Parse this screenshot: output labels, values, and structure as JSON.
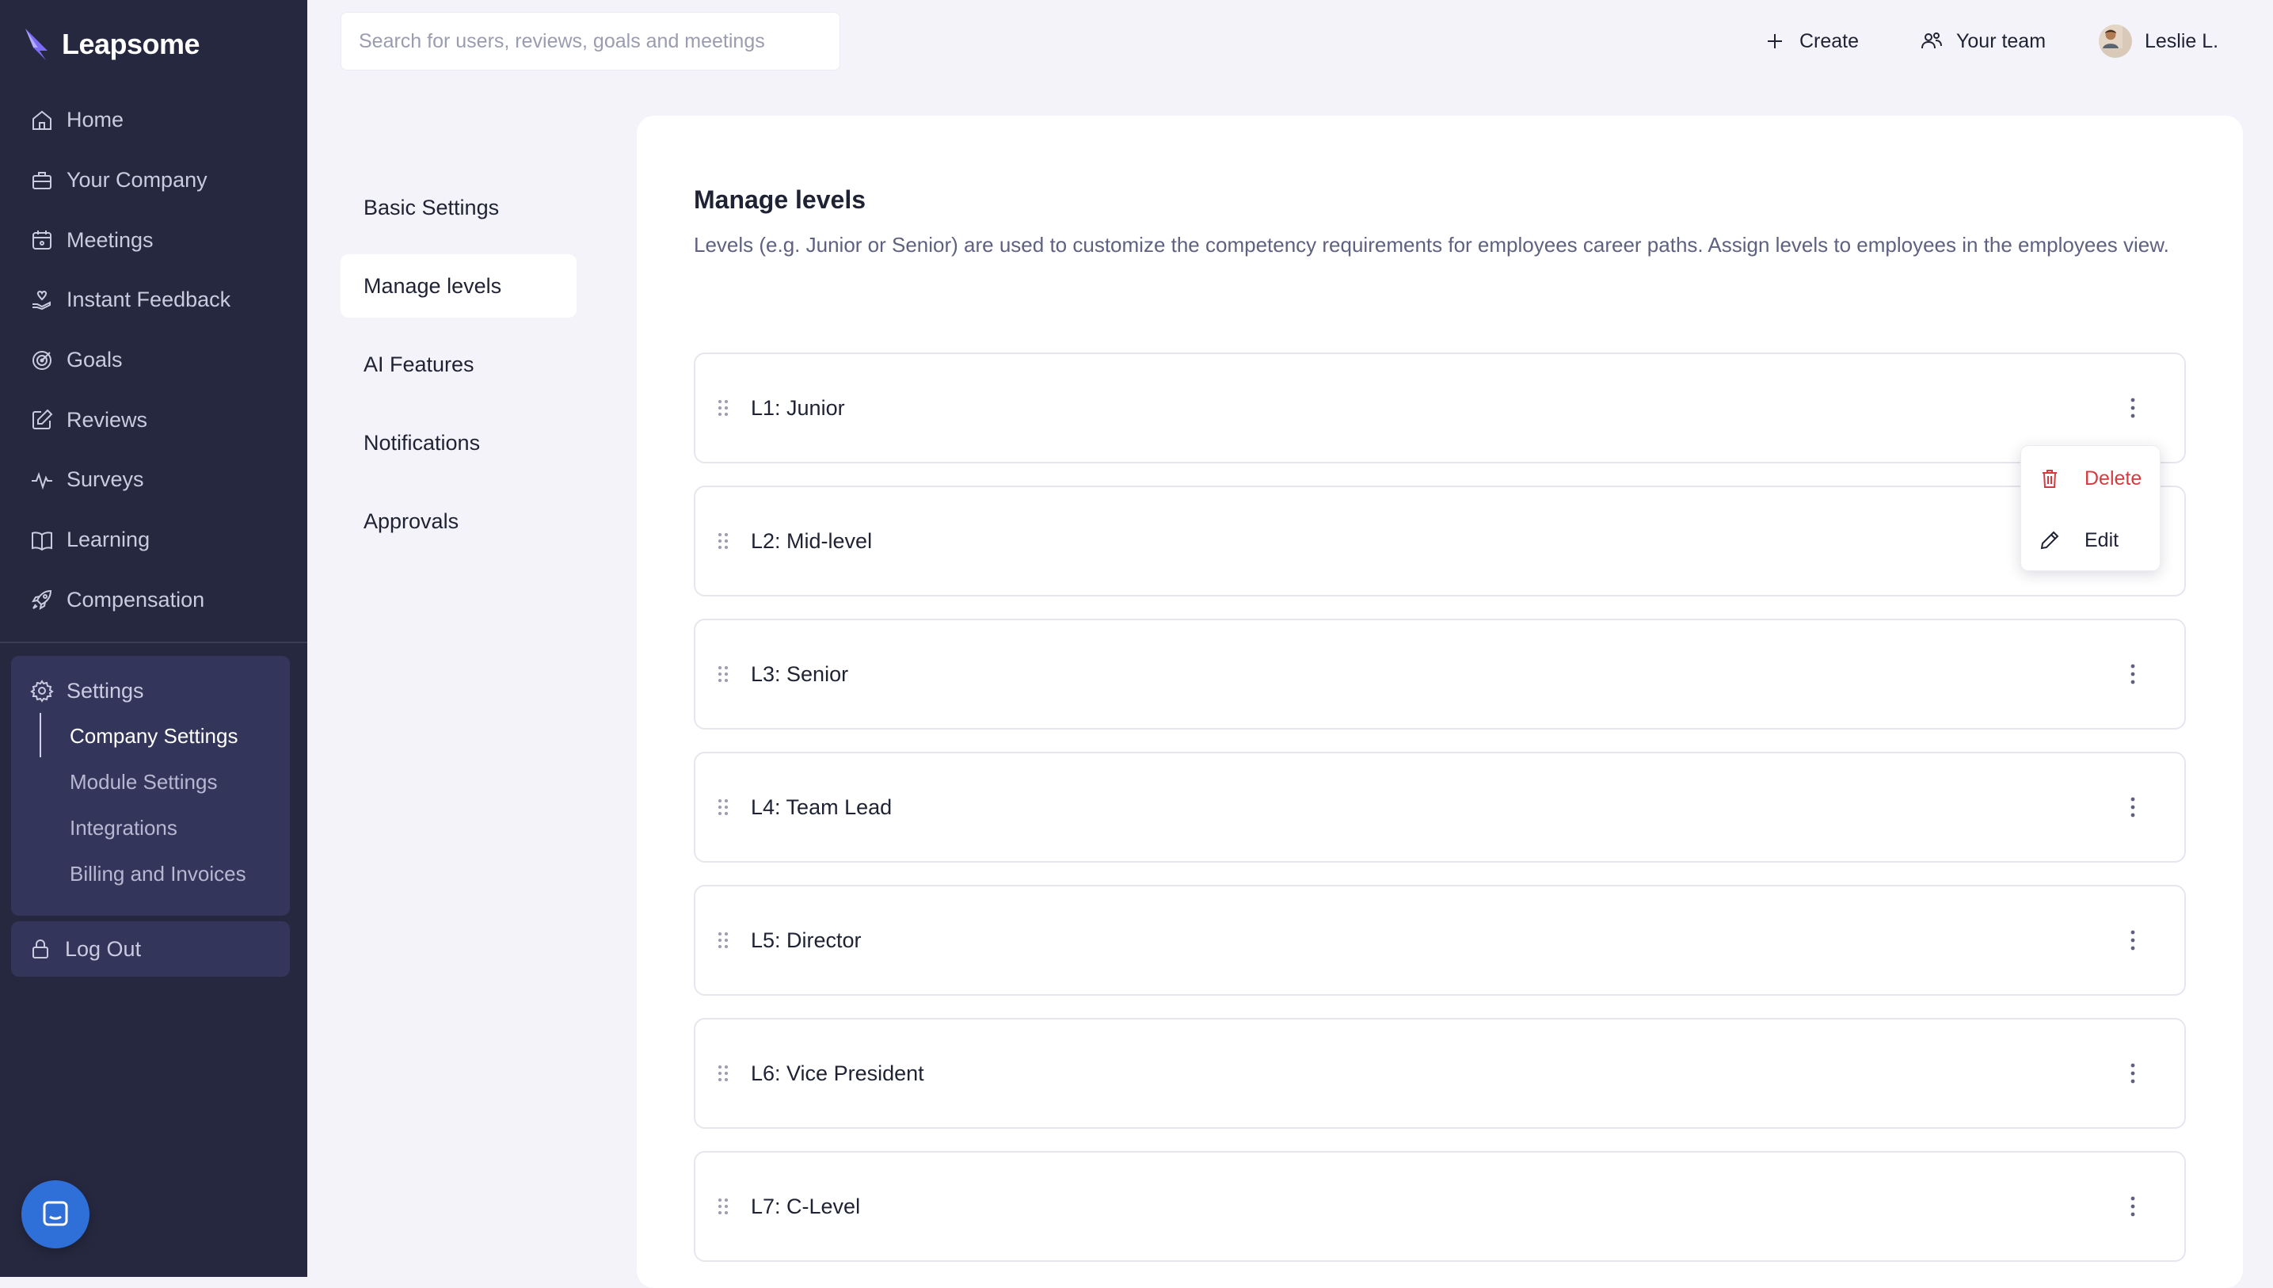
{
  "app": {
    "name": "Leapsome"
  },
  "sidebar": {
    "items": [
      {
        "label": "Home",
        "icon": "home-icon"
      },
      {
        "label": "Your Company",
        "icon": "briefcase-icon"
      },
      {
        "label": "Meetings",
        "icon": "calendar-icon"
      },
      {
        "label": "Instant Feedback",
        "icon": "hand-heart-icon"
      },
      {
        "label": "Goals",
        "icon": "target-icon"
      },
      {
        "label": "Reviews",
        "icon": "pen-square-icon"
      },
      {
        "label": "Surveys",
        "icon": "pulse-icon"
      },
      {
        "label": "Learning",
        "icon": "book-icon"
      },
      {
        "label": "Compensation",
        "icon": "rocket-icon"
      }
    ],
    "settings": {
      "label": "Settings",
      "sub_items": [
        {
          "label": "Company Settings",
          "active": true
        },
        {
          "label": "Module Settings",
          "active": false
        },
        {
          "label": "Integrations",
          "active": false
        },
        {
          "label": "Billing and Invoices",
          "active": false
        }
      ]
    },
    "logout_label": "Log Out"
  },
  "header": {
    "search_placeholder": "Search for users, reviews, goals and meetings",
    "create_label": "Create",
    "team_label": "Your team",
    "user_name": "Leslie L."
  },
  "subnav": {
    "items": [
      {
        "label": "Basic Settings",
        "active": false
      },
      {
        "label": "Manage levels",
        "active": true
      },
      {
        "label": "AI Features",
        "active": false
      },
      {
        "label": "Notifications",
        "active": false
      },
      {
        "label": "Approvals",
        "active": false
      }
    ]
  },
  "main": {
    "title": "Manage levels",
    "description": "Levels (e.g. Junior or Senior) are used to customize the competency requirements for employees career paths. Assign levels to employees in the employees view.",
    "levels": [
      {
        "label": "L1: Junior"
      },
      {
        "label": "L2: Mid-level"
      },
      {
        "label": "L3: Senior"
      },
      {
        "label": "L4: Team Lead"
      },
      {
        "label": "L5: Director"
      },
      {
        "label": "L6: Vice President"
      },
      {
        "label": "L7: C-Level"
      }
    ]
  },
  "context_menu": {
    "delete_label": "Delete",
    "edit_label": "Edit"
  },
  "colors": {
    "sidebar_bg": "#262840",
    "page_bg": "#f3f3f9",
    "danger": "#d6393e",
    "chat_blue": "#2f6fd8"
  }
}
